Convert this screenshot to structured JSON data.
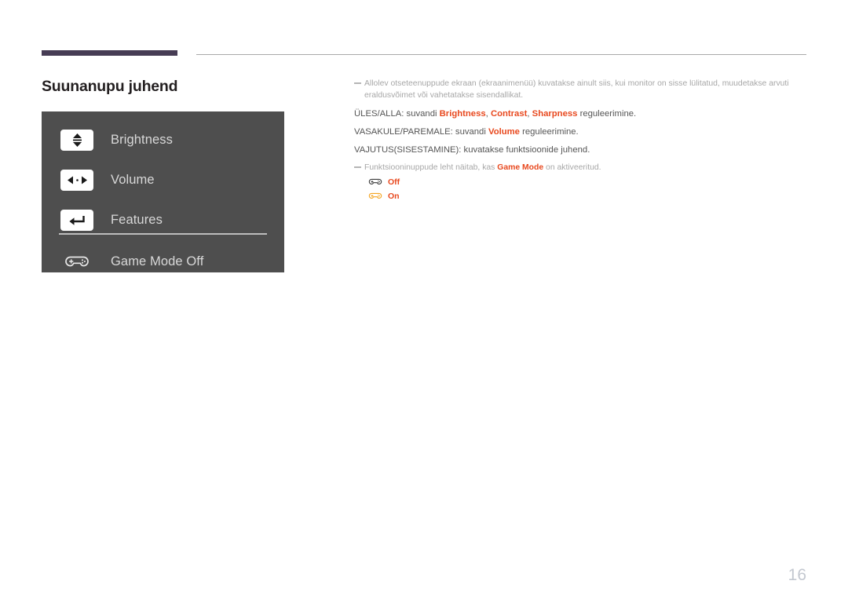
{
  "header": {
    "rule_accent_color": "#463c54",
    "rule_line_color": "#a9a9a9"
  },
  "page_title": "Suunanupu juhend",
  "osd_panel": {
    "background_color": "#4e4e4e",
    "rows": [
      {
        "icon": "up-down-arrows-icon",
        "label": "Brightness"
      },
      {
        "icon": "left-right-arrows-icon",
        "label": "Volume"
      },
      {
        "icon": "enter-return-arrow-icon",
        "label": "Features"
      },
      {
        "icon": "gamepad-icon",
        "label": "Game Mode Off"
      }
    ]
  },
  "notes": {
    "note1": "Allolev otseteenuppude ekraan (ekraanimenüü) kuvatakse ainult siis, kui monitor on sisse lülitatud, muudetakse arvuti eraldusvõimet või vahetatakse sisendallikat.",
    "note2_prefix": "Funktsiooninuppude leht näitab, kas ",
    "note2_highlight": "Game Mode",
    "note2_suffix": " on aktiveeritud."
  },
  "instructions": [
    {
      "prefix": "ÜLES/ALLA: suvandi ",
      "highlights": [
        "Brightness",
        "Contrast",
        "Sharpness"
      ],
      "suffix": " reguleerimine."
    },
    {
      "prefix": "VASAKULE/PAREMALE: suvandi ",
      "highlights": [
        "Volume"
      ],
      "suffix": " reguleerimine."
    },
    {
      "prefix": "VAJUTUS(SISESTAMINE): kuvatakse funktsioonide juhend.",
      "highlights": [],
      "suffix": ""
    }
  ],
  "game_mode_legend": [
    {
      "icon": "gamepad-outline-dark-icon",
      "label": "Off",
      "color": "#3a3a3a"
    },
    {
      "icon": "gamepad-outline-orange-icon",
      "label": "On",
      "color": "#f5a623"
    }
  ],
  "accent_color": "#e8491f",
  "page_number": "16"
}
